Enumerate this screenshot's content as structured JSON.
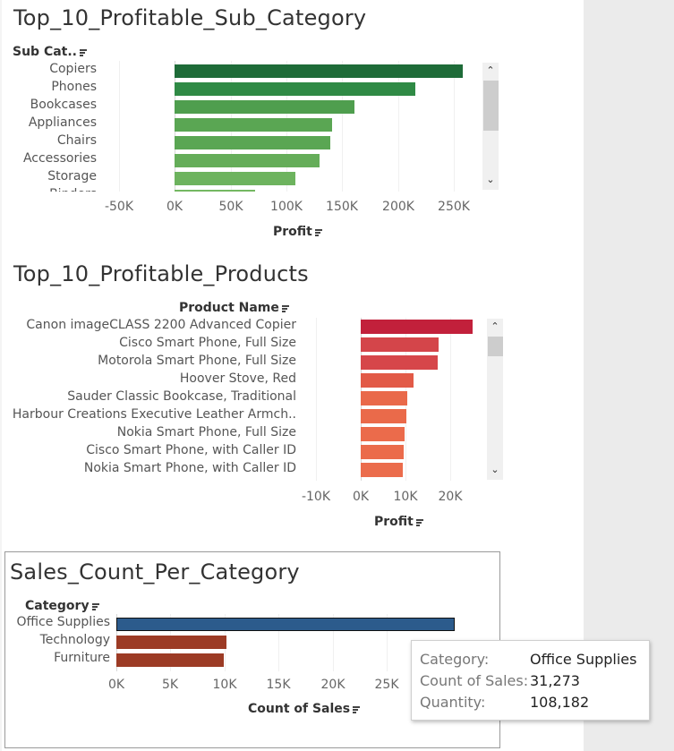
{
  "chart_data": [
    {
      "type": "bar",
      "title": "Top_10_Profitable_Sub_Category",
      "row_header": "Sub Cat..",
      "xlabel": "Profit",
      "orientation": "horizontal",
      "categories": [
        "Copiers",
        "Phones",
        "Bookcases",
        "Appliances",
        "Chairs",
        "Accessories",
        "Storage",
        "Binders"
      ],
      "values": [
        258000,
        216000,
        161000,
        141000,
        140000,
        130000,
        108000,
        72000
      ],
      "xlim": [
        -70000,
        275000
      ],
      "xticks": [
        "-50K",
        "0K",
        "50K",
        "100K",
        "150K",
        "200K",
        "250K"
      ],
      "colors": [
        "#1e6b38",
        "#2f8a45",
        "#4f9e4e",
        "#5aa653",
        "#5aa653",
        "#65ad59",
        "#6db35e",
        "#74b862"
      ]
    },
    {
      "type": "bar",
      "title": "Top_10_Profitable_Products",
      "row_header": "Product Name",
      "xlabel": "Profit",
      "orientation": "horizontal",
      "categories": [
        "Canon imageCLASS 2200 Advanced Copier",
        "Cisco Smart Phone, Full Size",
        "Motorola Smart Phone, Full Size",
        "Hoover Stove, Red",
        "Sauder Classic Bookcase, Traditional",
        "Harbour Creations Executive Leather Armch..",
        "Nokia Smart Phone, Full Size",
        "Cisco Smart Phone, with Caller ID",
        "Nokia Smart Phone, with Caller ID"
      ],
      "values": [
        25000,
        17500,
        17200,
        11800,
        10500,
        10300,
        9800,
        9700,
        9500
      ],
      "xlim": [
        -12000,
        27500
      ],
      "xticks": [
        "-10K",
        "0K",
        "10K",
        "20K"
      ],
      "colors": [
        "#c2203b",
        "#d4454a",
        "#d6464a",
        "#e25a47",
        "#e9694a",
        "#ea6a4a",
        "#eb6b4b",
        "#eb6b4b",
        "#eb6c4c"
      ]
    },
    {
      "type": "bar",
      "title": "Sales_Count_Per_Category",
      "row_header": "Category",
      "xlabel": "Count of Sales",
      "orientation": "horizontal",
      "categories": [
        "Office Supplies",
        "Technology",
        "Furniture"
      ],
      "values": [
        31273,
        10141,
        9876
      ],
      "xlim": [
        -800,
        32500
      ],
      "xticks": [
        "0K",
        "5K",
        "10K",
        "15K",
        "20K",
        "25K"
      ],
      "colors": [
        "#2c5b8c",
        "#9c3b25",
        "#9c3b25"
      ],
      "highlighted": "Office Supplies"
    }
  ],
  "tooltip": {
    "rows": [
      {
        "key": "Category:",
        "value": "Office Supplies"
      },
      {
        "key": "Count of Sales:",
        "value": "31,273"
      },
      {
        "key": "Quantity:",
        "value": "108,182"
      }
    ]
  },
  "scroll_icons": {
    "up": "chevron-up-icon",
    "down": "chevron-down-icon"
  }
}
